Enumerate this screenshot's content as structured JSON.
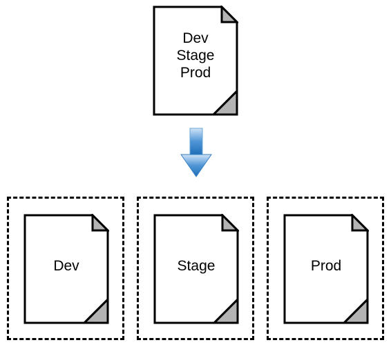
{
  "diagram": {
    "source_doc": {
      "line1": "Dev",
      "line2": "Stage",
      "line3": "Prod"
    },
    "targets": {
      "dev": {
        "label": "Dev"
      },
      "stage": {
        "label": "Stage"
      },
      "prod": {
        "label": "Prod"
      }
    },
    "colors": {
      "outline": "#000000",
      "fold_fill": "#b3b3b3",
      "arrow_top": "#bcd9f2",
      "arrow_bottom": "#1f6fb8",
      "dash": "#000000"
    }
  }
}
